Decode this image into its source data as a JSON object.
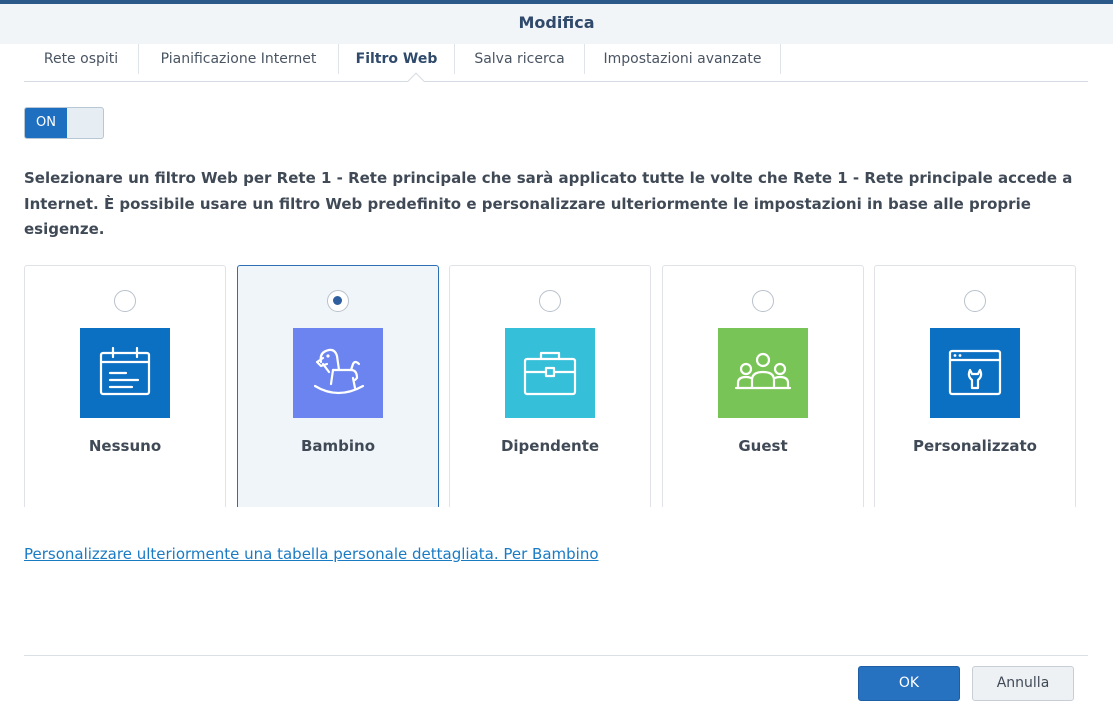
{
  "window": {
    "title": "Modifica"
  },
  "tabs": [
    {
      "label": "Rete ospiti"
    },
    {
      "label": "Pianificazione Internet"
    },
    {
      "label": "Filtro Web"
    },
    {
      "label": "Salva ricerca"
    },
    {
      "label": "Impostazioni avanzate"
    }
  ],
  "active_tab": "Filtro Web",
  "toggle": {
    "label": "ON",
    "state": true
  },
  "description": "Selezionare un filtro Web per Rete 1 - Rete principale che sarà applicato tutte le volte che Rete 1 - Rete principale accede a Internet. È possibile usare un filtro Web predefinito e personalizzare ulteriormente le impostazioni in base alle proprie esigenze.",
  "profiles": [
    {
      "label": "Nessuno",
      "icon": "calendar-list-icon",
      "color": "#0b6fc2",
      "selected": false
    },
    {
      "label": "Bambino",
      "icon": "rocking-horse-icon",
      "color": "#6b84ef",
      "selected": true
    },
    {
      "label": "Dipendente",
      "icon": "briefcase-icon",
      "color": "#35bfd8",
      "selected": false
    },
    {
      "label": "Guest",
      "icon": "group-icon",
      "color": "#79c456",
      "selected": false
    },
    {
      "label": "Personalizzato",
      "icon": "browser-wrench-icon",
      "color": "#0b6fc2",
      "selected": false
    }
  ],
  "custom_link": "Personalizzare ulteriormente una tabella personale dettagliata. Per Bambino",
  "buttons": {
    "ok": "OK",
    "cancel": "Annulla"
  }
}
